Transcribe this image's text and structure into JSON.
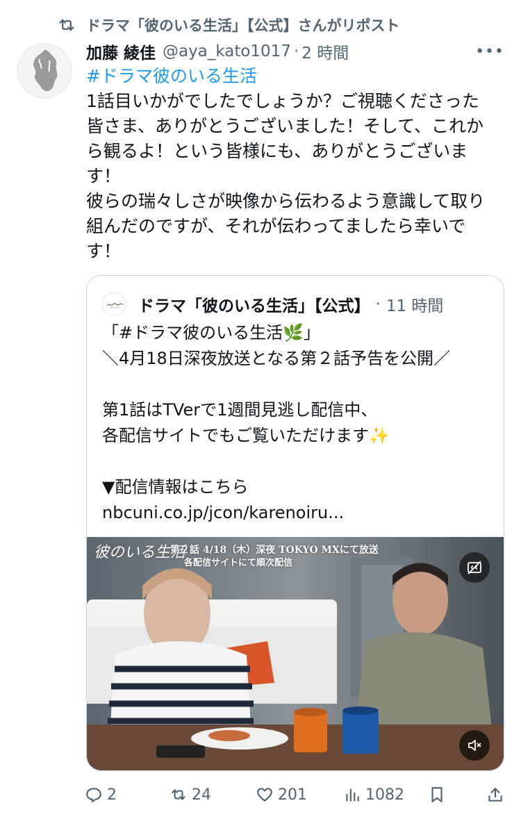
{
  "repost": {
    "text": "ドラマ「彼のいる生活」【公式】さんがリポスト",
    "icon": "repost-icon"
  },
  "tweet": {
    "author_name": "加藤 綾佳",
    "handle": "@aya_kato1017",
    "separator": "·",
    "time": "2 時間",
    "more_label": "•••",
    "hashtag": "#ドラマ彼のいる生活",
    "lines": [
      "1話目いかがでしたでしょうか？ご視聴くださった",
      "皆さま、ありがとうございました！そして、これか",
      "ら観るよ！という皆様にも、ありがとうございま",
      "す！",
      "彼らの瑞々しさが映像から伝わるよう意識して取り",
      "組んだのですが、それが伝わってましたら幸いで",
      "す！"
    ]
  },
  "quote": {
    "author_name": "ドラマ「彼のいる生活」【公式】",
    "separator": "·",
    "time": "11 時間",
    "lines": [
      "「#ドラマ彼のいる生活🌿」",
      "＼4月18日深夜放送となる第２話予告を公開／",
      "",
      "第1話はTVerで1週間見逃し配信中、",
      "各配信サイトでもご覧いただけます✨",
      "",
      "▼配信情報はこちら",
      "nbcuni.co.jp/jcon/karenoiru..."
    ],
    "video": {
      "title_logo": "彼のいる生活",
      "caption_line1": "第２話 4/18（木）深夜 TOKYO MXにて放送",
      "caption_line2": "各配信サイトにて順次配信"
    }
  },
  "actions": {
    "replies": "2",
    "reposts": "24",
    "likes": "201",
    "views": "1082"
  },
  "colors": {
    "accent": "#1d9bf0",
    "secondary_text": "#536471",
    "border": "#cfd9de"
  }
}
